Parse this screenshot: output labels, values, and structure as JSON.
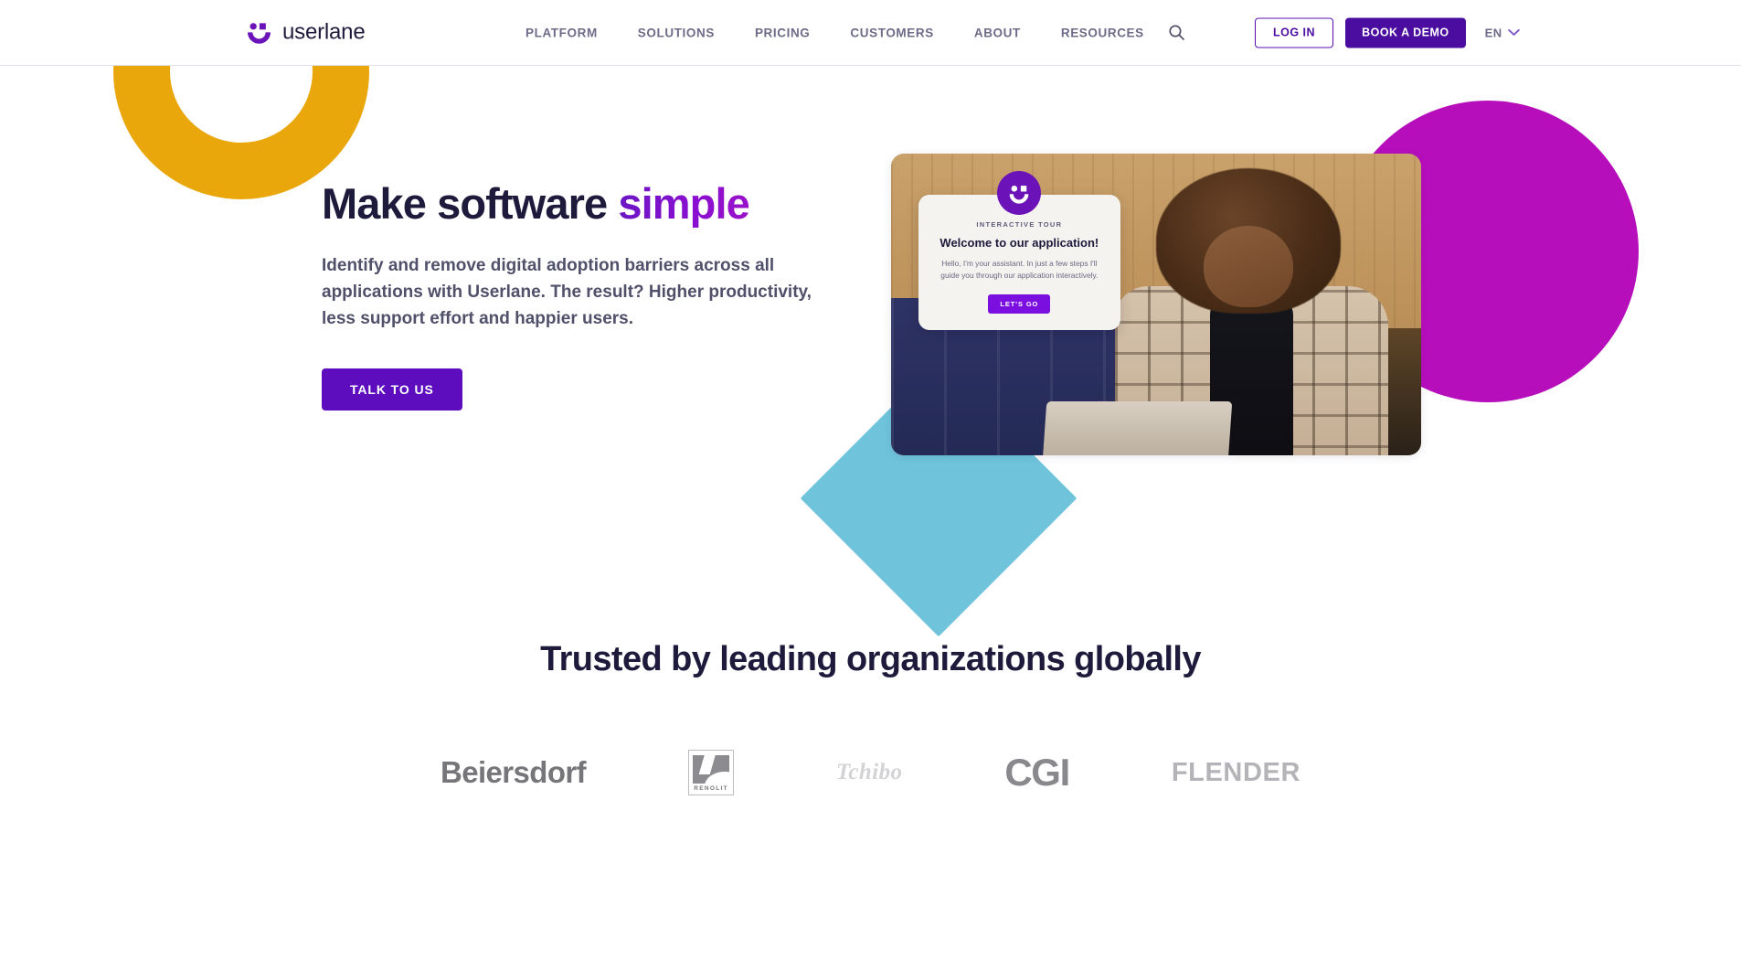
{
  "brand": {
    "name": "userlane",
    "logo_icon": "userlane-smiley-logo"
  },
  "colors": {
    "brand_purple": "#5B0FB5",
    "deep_purple": "#4B0CA0",
    "accent_magenta": "#B70EBC",
    "accent_yellow": "#E9A70C",
    "accent_teal": "#6FC4DC",
    "navy_text": "#1E1A3C",
    "muted_text": "#6D6B87"
  },
  "header": {
    "nav": [
      {
        "label": "PLATFORM"
      },
      {
        "label": "SOLUTIONS"
      },
      {
        "label": "PRICING"
      },
      {
        "label": "CUSTOMERS"
      },
      {
        "label": "ABOUT"
      },
      {
        "label": "RESOURCES"
      }
    ],
    "search_icon": "search-icon",
    "login_label": "LOG IN",
    "demo_label": "BOOK A DEMO",
    "language": "EN",
    "language_chevron": "chevron-down-icon"
  },
  "hero": {
    "title_main": "Make software ",
    "title_accent": "simple",
    "subtitle": "Identify and remove digital adoption barriers across all applications with Userlane. The result? Higher productivity, less support effort and happier users.",
    "cta_label": "TALK TO US",
    "image_alt": "Smiling woman with curly hair using a laptop on a blue velvet sofa"
  },
  "tour_card": {
    "avatar_icon": "userlane-smiley-avatar-icon",
    "eyebrow": "INTERACTIVE TOUR",
    "title": "Welcome to our application!",
    "body": "Hello, I'm your assistant. In just a few steps I'll guide you through our application interactively.",
    "button_label": "LET'S GO"
  },
  "trusted": {
    "title": "Trusted by leading organizations globally",
    "logos": [
      {
        "name": "Beiersdorf"
      },
      {
        "name": "RENOLIT"
      },
      {
        "name": "Tchibo"
      },
      {
        "name": "CGI"
      },
      {
        "name": "FLENDER"
      }
    ]
  }
}
